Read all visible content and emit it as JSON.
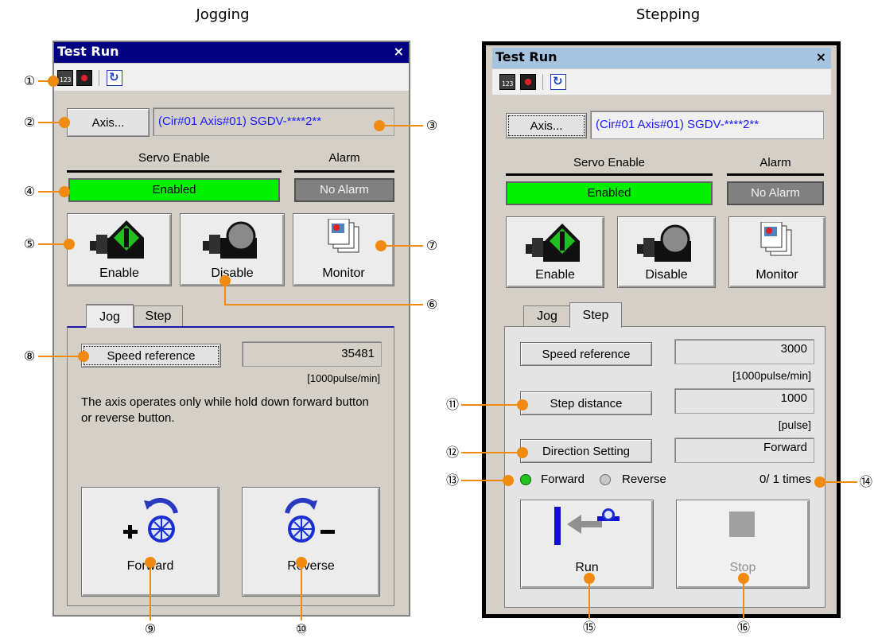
{
  "headings": {
    "left": "Jogging",
    "right": "Stepping"
  },
  "window": {
    "title": "Test Run",
    "close": "×"
  },
  "toolbar": {
    "icons": [
      "calculator-icon",
      "stop-icon",
      "refresh-icon"
    ]
  },
  "axis": {
    "button": "Axis...",
    "value": "(Cir#01 Axis#01) SGDV-****2**"
  },
  "status": {
    "servo_enable_label": "Servo Enable",
    "alarm_label": "Alarm",
    "servo_value": "Enabled",
    "alarm_value": "No Alarm"
  },
  "buttons": {
    "enable": "Enable",
    "disable": "Disable",
    "monitor": "Monitor"
  },
  "tabs": {
    "jog": "Jog",
    "step": "Step"
  },
  "jog": {
    "speed_button": "Speed reference",
    "speed_value": "35481",
    "speed_unit": "[1000pulse/min]",
    "description": "The axis operates only while hold down forward button or reverse button.",
    "forward": "Forward",
    "reverse": "Reverse"
  },
  "step": {
    "speed_button": "Speed reference",
    "speed_value": "3000",
    "speed_unit": "[1000pulse/min]",
    "distance_button": "Step distance",
    "distance_value": "1000",
    "distance_unit": "[pulse]",
    "direction_button": "Direction Setting",
    "direction_value": "Forward",
    "indicator_forward": "Forward",
    "indicator_reverse": "Reverse",
    "counter": "0/ 1 times",
    "run": "Run",
    "stop": "Stop"
  },
  "callouts": [
    "①",
    "②",
    "③",
    "④",
    "⑤",
    "⑥",
    "⑦",
    "⑧",
    "⑨",
    "⑩",
    "⑪",
    "⑫",
    "⑬",
    "⑭",
    "⑮",
    "⑯"
  ],
  "colors": {
    "accent": "#f08a10",
    "enabled": "#00f000",
    "title_active": "#000080",
    "title_light": "#a6c4e0",
    "axis_text": "#1a1aff"
  }
}
